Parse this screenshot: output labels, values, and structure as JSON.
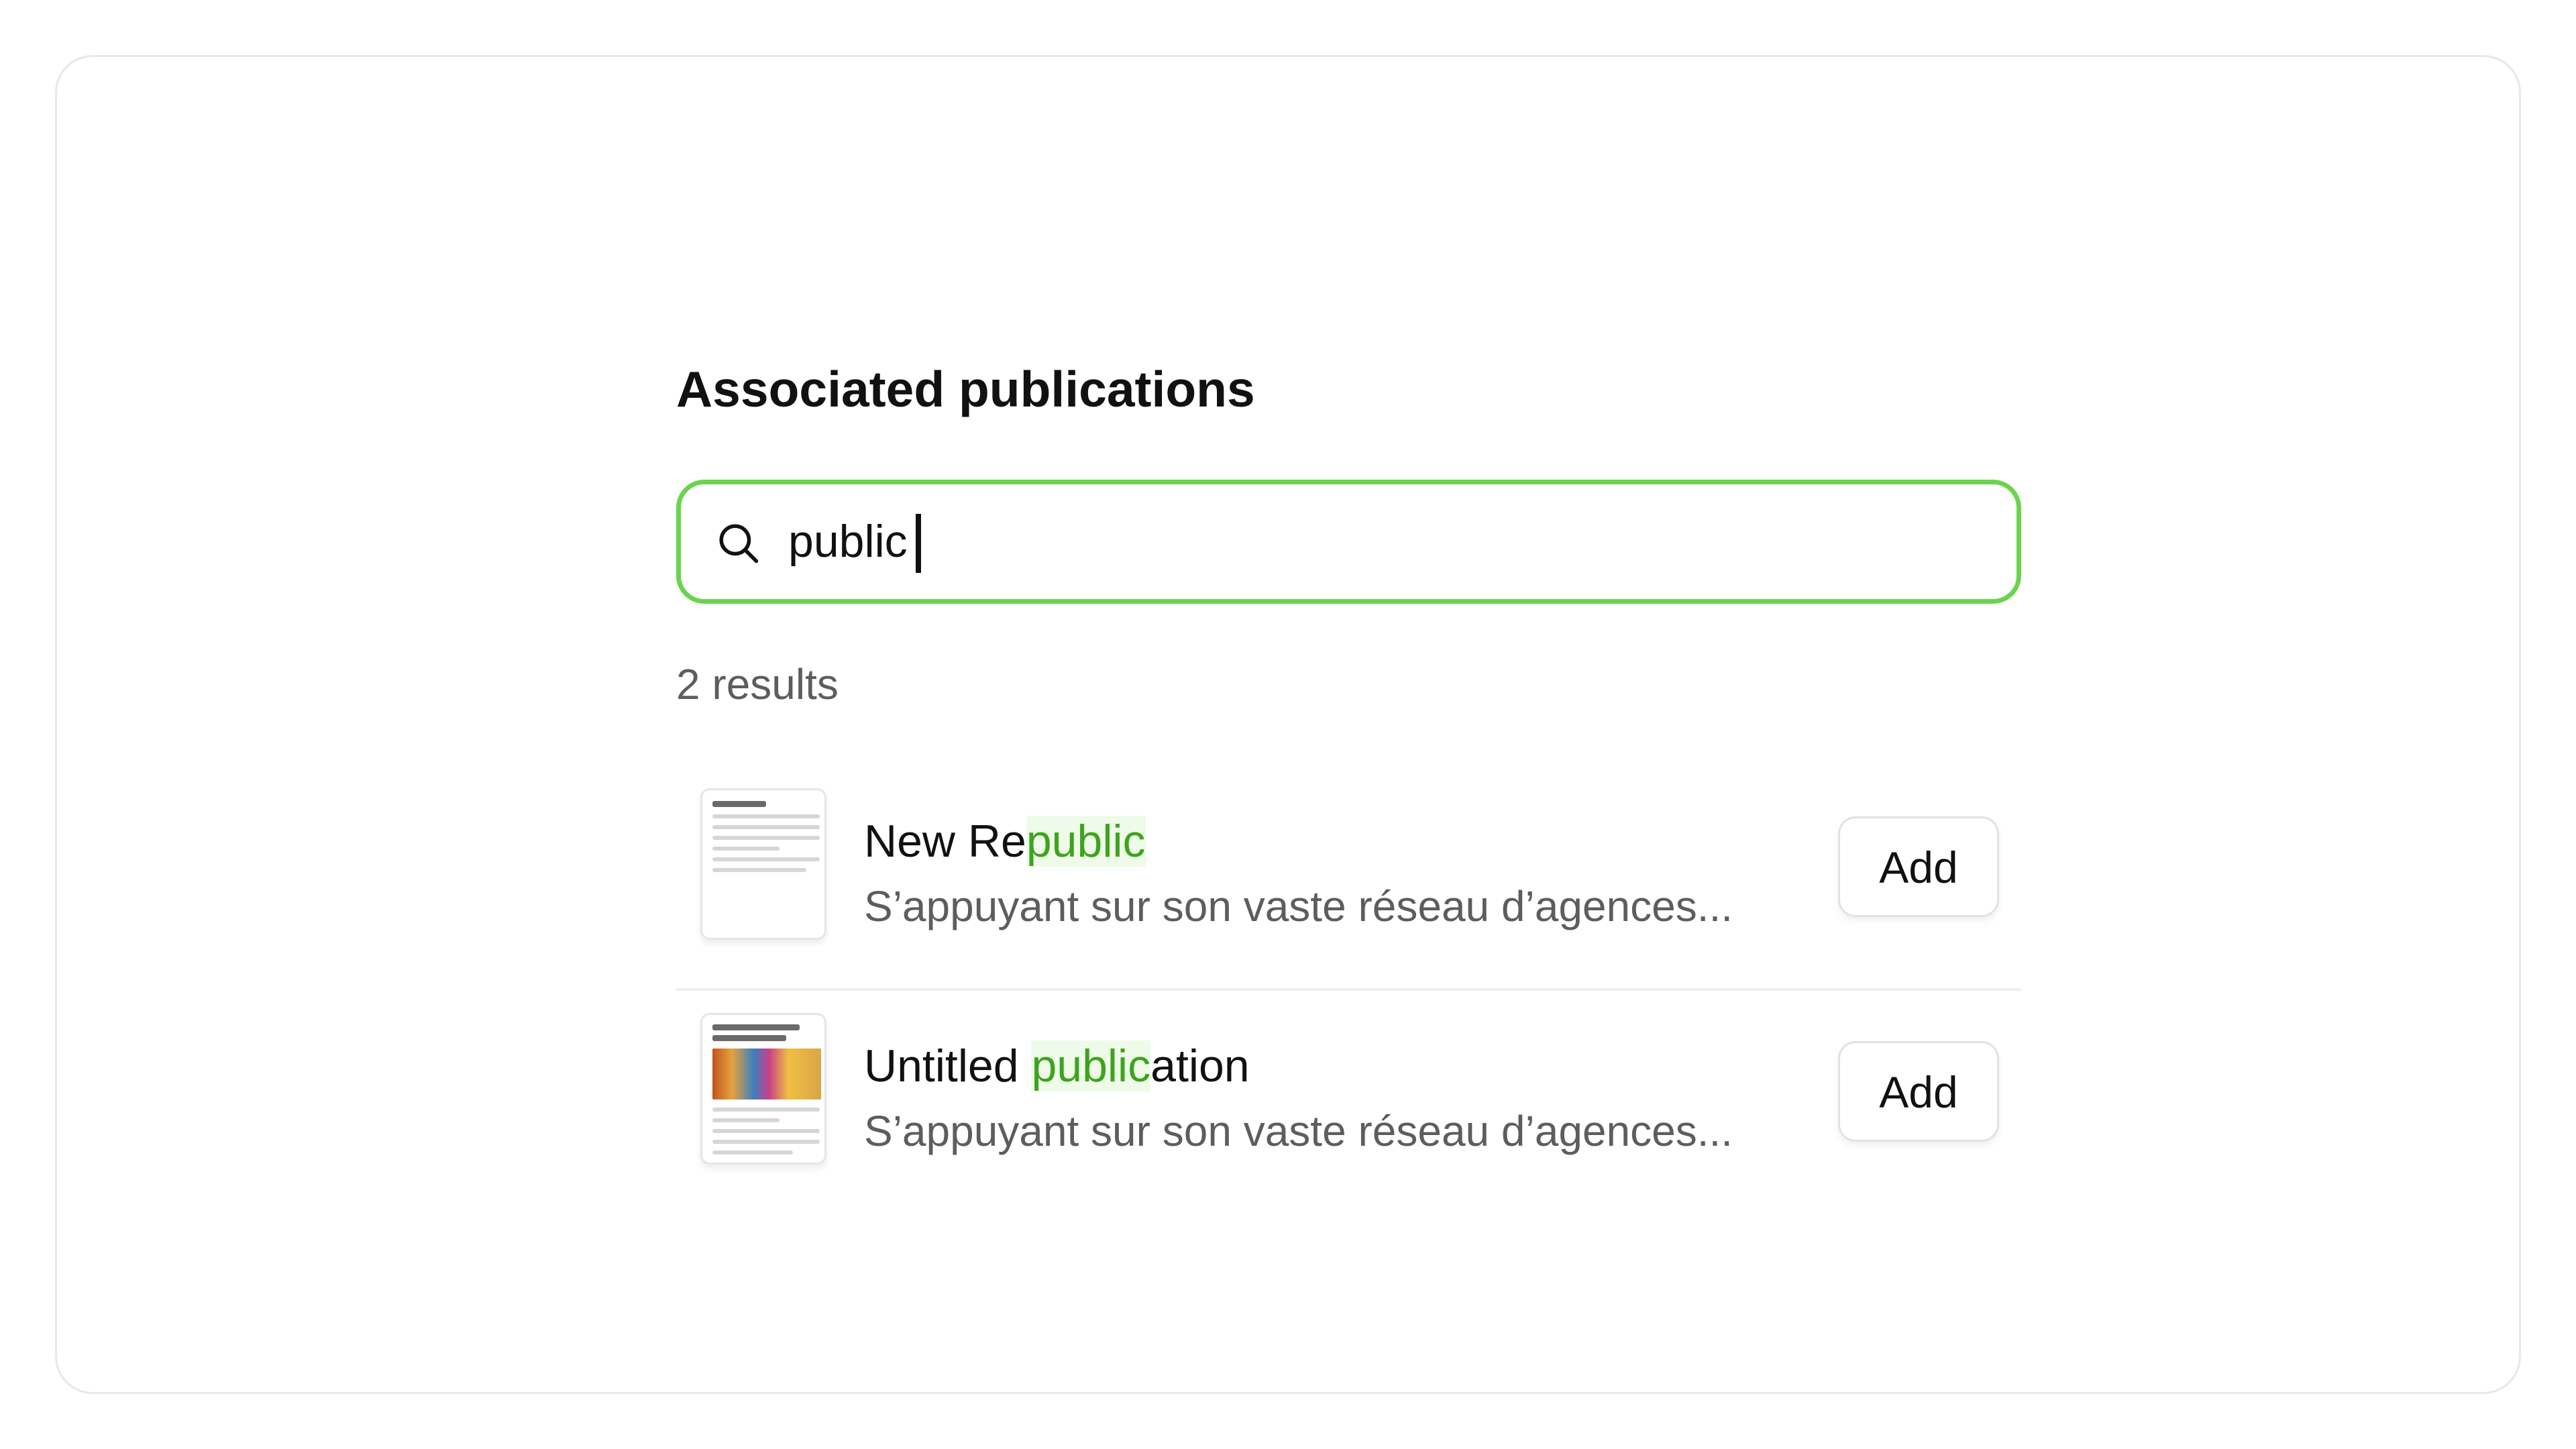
{
  "section": {
    "title": "Associated publications"
  },
  "search": {
    "value": "public",
    "icon": "search-icon",
    "accent_color": "#6bd44f"
  },
  "results": {
    "count_label": "2 results",
    "items": [
      {
        "title_before": "New Re",
        "title_match": "public",
        "title_after": "",
        "description": "S’appuyant sur son vaste réseau d’agences...",
        "add_label": "Add"
      },
      {
        "title_before": "Untitled ",
        "title_match": "public",
        "title_after": "ation",
        "description": "S’appuyant sur son vaste réseau d’agences...",
        "add_label": "Add"
      }
    ],
    "highlight_color": "#3ea31e"
  }
}
